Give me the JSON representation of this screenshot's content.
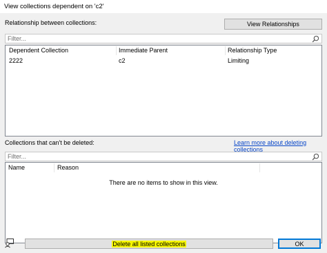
{
  "window": {
    "title": "View collections dependent on 'c2'"
  },
  "relationships": {
    "section_label": "Relationship between collections:",
    "view_button": "View Relationships",
    "filter_placeholder": "Filter...",
    "columns": [
      "Dependent Collection",
      "Immediate Parent",
      "Relationship Type"
    ],
    "rows": [
      [
        "2222",
        "c2",
        "Limiting"
      ]
    ]
  },
  "undeletable": {
    "section_label": "Collections that can't be deleted:",
    "learn_more_link": "Learn more about deleting collections",
    "filter_placeholder": "Filter...",
    "columns": [
      "Name",
      "Reason"
    ],
    "empty_message": "There are no items to show in this view."
  },
  "footer": {
    "delete_button": "Delete all listed collections",
    "ok_button": "OK"
  },
  "icons": {
    "search": "search-icon",
    "feedback": "feedback-icon"
  },
  "colors": {
    "dialog_bg": "#f0f0f0",
    "highlight": "#f5f500",
    "link": "#0645c8",
    "ok_border": "#0078d7"
  }
}
